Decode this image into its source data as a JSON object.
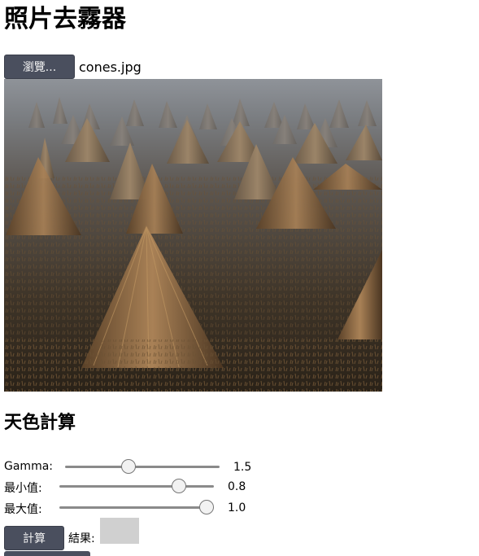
{
  "title": "照片去霧器",
  "file_input": {
    "browse_label": "瀏覽...",
    "file_name": "cones.jpg"
  },
  "photo": {
    "subject": "straw cones in a harvested rice field"
  },
  "section_title": "天色計算",
  "sliders": [
    {
      "label": "Gamma:",
      "value": "1.5"
    },
    {
      "label": "最小值:",
      "value": "0.8"
    },
    {
      "label": "最大值:",
      "value": "1.0"
    }
  ],
  "calc_button": "計算",
  "result_label": "結果:",
  "colors": {
    "button_bg": "#4a4f5e",
    "result_swatch": "#d0d0d0"
  }
}
